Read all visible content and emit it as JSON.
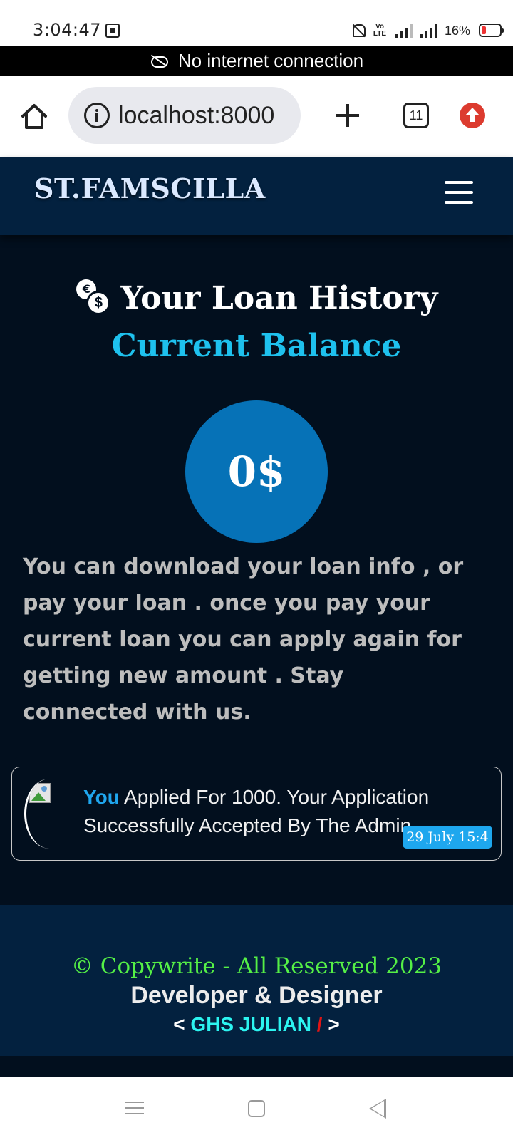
{
  "status_bar": {
    "time": "3:04:47",
    "network_label": "Vo LTE",
    "battery": "16%"
  },
  "offline_banner": {
    "text": "No internet connection",
    "icon": "cloud-off-icon"
  },
  "browser": {
    "url": "localhost:8000",
    "tab_count": "11",
    "icons": [
      "home-icon",
      "info-icon",
      "plus-icon",
      "tabs-icon",
      "update-icon"
    ]
  },
  "navbar": {
    "brand": "ST.FAMSCILLA",
    "menu_icon": "hamburger-icon"
  },
  "main": {
    "title": "Your Loan History",
    "title_icon": "coins-icon",
    "balance_label": "Current Balance",
    "balance_value": "0$",
    "coin_symbols": {
      "euro": "€",
      "dollar": "$"
    },
    "info_text": "You can download your loan info , or pay your loan . once you pay your current loan you can apply again for getting new amount . Stay connected with us."
  },
  "notifications": [
    {
      "subject": "You",
      "message": "Applied For 1000. Your Application Successfully Accepted By The Admin",
      "date": "29 July 15:4"
    }
  ],
  "footer": {
    "copyright": "© Copywrite - All Reserved 2023",
    "developer_label": "Developer & Designer",
    "author_open": "<",
    "author_name": "GHS JULIAN",
    "author_slash": "/",
    "author_close": ">"
  },
  "colors": {
    "page_bg": "#020f1e",
    "navbar_bg": "#03213f",
    "accent_cyan": "#1ec1ee",
    "balance_circle": "#0672b7",
    "copyright_green": "#55f046"
  }
}
